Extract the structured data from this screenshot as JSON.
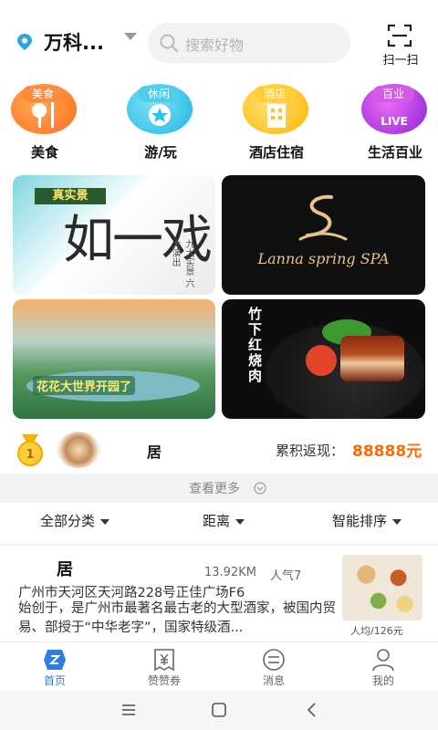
{
  "header": {
    "location": "万科...",
    "search_placeholder": "搜索好物",
    "scan_label": "扫一扫"
  },
  "categories": [
    {
      "tag": "美食",
      "label": "美食",
      "color": "#ff7a1a"
    },
    {
      "tag": "休闲",
      "label": "游/玩",
      "color": "#2cc3e8"
    },
    {
      "tag": "酒店",
      "label": "酒店住宿",
      "color": "#ffc316"
    },
    {
      "tag": "百业",
      "label": "生活百业",
      "color": "#c73be0",
      "badge": "LIVE"
    }
  ],
  "banners": {
    "b1_tag": "真实景",
    "b1_big": "如一戏",
    "b1_side": "九大实景 六大演出",
    "b2_text": "Lanna spring SPA",
    "b3_text": "花花大世界开园了",
    "b4_text": "竹下红烧肉"
  },
  "rank": {
    "medal_number": "1",
    "name": "居",
    "label": "累积返现：",
    "value": "88888元"
  },
  "see_more": "查看更多",
  "filters": [
    "全部分类",
    "距离",
    "智能排序"
  ],
  "store": {
    "name": "居",
    "distance": "13.92KM",
    "popularity": "人气7",
    "address": "广州市天河区天河路228号正佳广场F6",
    "description": "始创于，是广州市最著名最古老的大型酒家，被国内贸易、部授于“中华老字”，国家特级酒...",
    "price": "人均/126元"
  },
  "tabs": [
    {
      "label": "首页",
      "active": true
    },
    {
      "label": "赞赞券",
      "active": false
    },
    {
      "label": "消息",
      "active": false
    },
    {
      "label": "我的",
      "active": false
    }
  ],
  "colors": {
    "accent_blue": "#2f7de1",
    "price_orange": "#ff6a00"
  }
}
